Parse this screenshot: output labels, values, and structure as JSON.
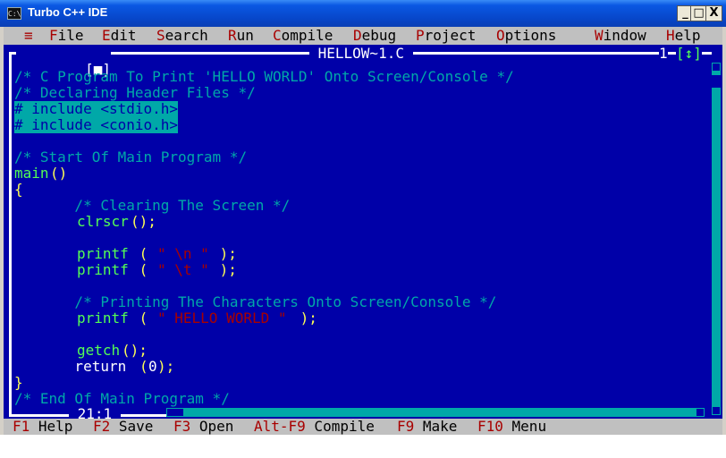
{
  "window": {
    "title": "Turbo C++ IDE",
    "icon_text": "C:\\"
  },
  "title_controls": {
    "minimize": "_",
    "maximize": "□",
    "close": "X"
  },
  "menu": {
    "system": "≡",
    "items": [
      {
        "hot": "F",
        "rest": "ile"
      },
      {
        "hot": "E",
        "rest": "dit"
      },
      {
        "hot": "S",
        "rest": "earch"
      },
      {
        "hot": "R",
        "rest": "un"
      },
      {
        "hot": "C",
        "rest": "ompile"
      },
      {
        "hot": "D",
        "rest": "ebug"
      },
      {
        "hot": "P",
        "rest": "roject"
      },
      {
        "hot": "O",
        "rest": "ptions"
      },
      {
        "hot": "W",
        "rest": "indow"
      },
      {
        "hot": "H",
        "rest": "elp"
      }
    ]
  },
  "editor": {
    "close_box": "[■]",
    "filename": " HELLOW~1.C ",
    "window_number": "1",
    "zoom_box": "[↕]",
    "cursor_pos": " 21:1 ",
    "code_lines": [
      [
        {
          "t": "/* C Program To Print 'HELLO WORLD' Onto Screen/Console */",
          "c": "cm"
        }
      ],
      [
        {
          "t": "/* Declaring Header Files */",
          "c": "cm"
        }
      ],
      [
        {
          "t": "# include <stdio.h>",
          "c": "hl"
        }
      ],
      [
        {
          "t": "# include <conio.h>",
          "c": "hl"
        }
      ],
      [],
      [
        {
          "t": "/* Start Of Main Program */",
          "c": "cm"
        }
      ],
      [
        {
          "t": "main",
          "c": "fn"
        },
        {
          "t": "()",
          "c": "pn"
        }
      ],
      [
        {
          "t": "{",
          "c": "pn"
        }
      ],
      [
        {
          "t": "       /* Clearing The Screen */",
          "c": "cm"
        }
      ],
      [
        {
          "t": "       ",
          "c": "kw"
        },
        {
          "t": "clrscr",
          "c": "fn"
        },
        {
          "t": "();",
          "c": "pn"
        }
      ],
      [],
      [
        {
          "t": "       ",
          "c": "kw"
        },
        {
          "t": "printf",
          "c": "fn"
        },
        {
          "t": " ( ",
          "c": "pn"
        },
        {
          "t": "\" \\n \"",
          "c": "st"
        },
        {
          "t": " );",
          "c": "pn"
        }
      ],
      [
        {
          "t": "       ",
          "c": "kw"
        },
        {
          "t": "printf",
          "c": "fn"
        },
        {
          "t": " ( ",
          "c": "pn"
        },
        {
          "t": "\" \\t \"",
          "c": "st"
        },
        {
          "t": " );",
          "c": "pn"
        }
      ],
      [],
      [
        {
          "t": "       /* Printing The Characters Onto Screen/Console */",
          "c": "cm"
        }
      ],
      [
        {
          "t": "       ",
          "c": "kw"
        },
        {
          "t": "printf",
          "c": "fn"
        },
        {
          "t": " ( ",
          "c": "pn"
        },
        {
          "t": "\" HELLO WORLD \"",
          "c": "st"
        },
        {
          "t": " );",
          "c": "pn"
        }
      ],
      [],
      [
        {
          "t": "       ",
          "c": "kw"
        },
        {
          "t": "getch",
          "c": "fn"
        },
        {
          "t": "();",
          "c": "pn"
        }
      ],
      [
        {
          "t": "       return ",
          "c": "kw"
        },
        {
          "t": "(",
          "c": "pn"
        },
        {
          "t": "0",
          "c": "kw"
        },
        {
          "t": ");",
          "c": "pn"
        }
      ],
      [
        {
          "t": "}",
          "c": "pn"
        }
      ],
      [
        {
          "t": "/* End Of Main Program */",
          "c": "cm"
        }
      ]
    ]
  },
  "status": [
    {
      "key": "F1",
      "label": " Help"
    },
    {
      "key": "F2",
      "label": " Save"
    },
    {
      "key": "F3",
      "label": " Open"
    },
    {
      "key": "Alt-F9",
      "label": " Compile"
    },
    {
      "key": "F9",
      "label": " Make"
    },
    {
      "key": "F10",
      "label": " Menu"
    }
  ],
  "colors": {
    "editor_bg": "#0000a8",
    "menu_bg": "#c0c0c0",
    "hotkey": "#a80000",
    "comment": "#00a8a8",
    "function": "#54fe54",
    "punct": "#fefe54",
    "string": "#a80000",
    "scrollbar": "#00a8a8"
  }
}
